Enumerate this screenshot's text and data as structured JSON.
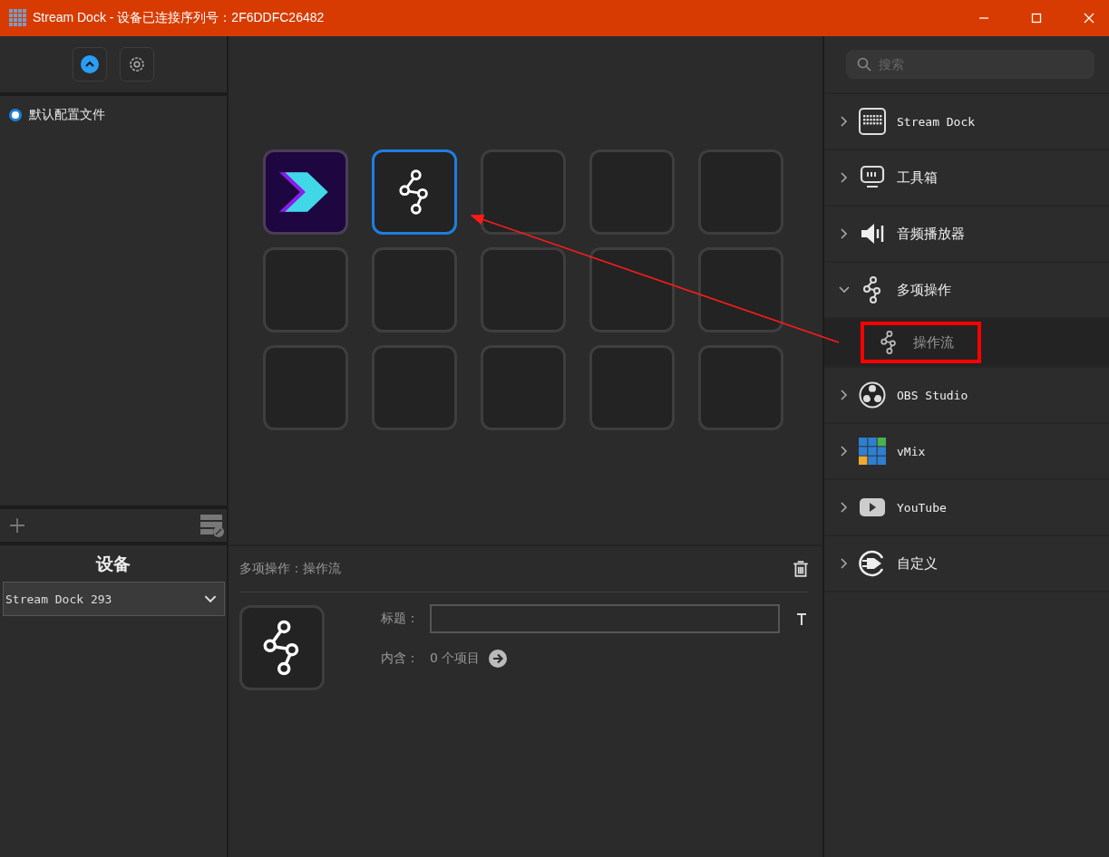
{
  "window": {
    "title": "Stream Dock - 设备已连接序列号：2F6DDFC26482"
  },
  "profiles": [
    {
      "label": "默认配置文件",
      "selected": true
    }
  ],
  "device": {
    "heading": "设备",
    "value": "Stream Dock 293"
  },
  "keys": [
    {
      "kind": "logo",
      "selected": false
    },
    {
      "kind": "flow",
      "selected": true
    },
    {
      "kind": "empty",
      "selected": false
    },
    {
      "kind": "empty",
      "selected": false
    },
    {
      "kind": "empty",
      "selected": false
    },
    {
      "kind": "empty",
      "selected": false
    },
    {
      "kind": "empty",
      "selected": false
    },
    {
      "kind": "empty",
      "selected": false
    },
    {
      "kind": "empty",
      "selected": false
    },
    {
      "kind": "empty",
      "selected": false
    },
    {
      "kind": "empty",
      "selected": false
    },
    {
      "kind": "empty",
      "selected": false
    },
    {
      "kind": "empty",
      "selected": false
    },
    {
      "kind": "empty",
      "selected": false
    },
    {
      "kind": "empty",
      "selected": false
    }
  ],
  "inspector": {
    "heading": "多项操作：操作流",
    "title_label": "标题：",
    "contains_label": "内含：",
    "contains_value": "0 个项目"
  },
  "search": {
    "placeholder": "搜索"
  },
  "categories": [
    {
      "label": "Stream Dock",
      "kind": "grid",
      "expanded": false
    },
    {
      "label": "工具箱",
      "kind": "monitor",
      "expanded": false
    },
    {
      "label": "音频播放器",
      "kind": "speaker",
      "expanded": false
    },
    {
      "label": "多项操作",
      "kind": "flow",
      "expanded": true,
      "children": [
        {
          "label": "操作流",
          "highlighted": true
        }
      ]
    },
    {
      "label": "OBS Studio",
      "kind": "obs",
      "expanded": false
    },
    {
      "label": "vMix",
      "kind": "vmix",
      "expanded": false
    },
    {
      "label": "YouTube",
      "kind": "youtube",
      "expanded": false
    },
    {
      "label": "自定义",
      "kind": "plug",
      "expanded": false
    }
  ]
}
